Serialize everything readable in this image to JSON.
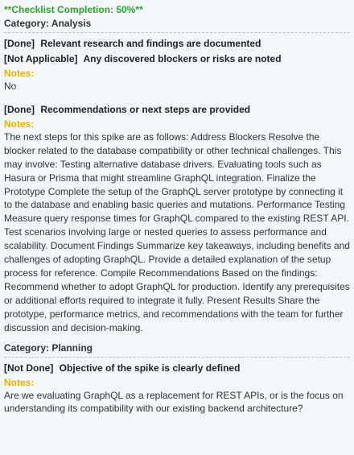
{
  "completion": "**Checklist Completion: 50%**",
  "categories": [
    {
      "label": "Category: Analysis",
      "items": [
        {
          "status": "[Done]",
          "text": "Relevant research and findings are documented"
        },
        {
          "status": "[Not Applicable]",
          "text": "Any discovered blockers or risks are noted",
          "notes_label": "Notes:",
          "notes": "No"
        },
        {
          "status": "[Done]",
          "text": "Recommendations or next steps are provided",
          "notes_label": "Notes:",
          "notes": "The next steps for this spike are as follows: Address Blockers Resolve the blocker related to the database compatibility or other technical challenges. This may involve: Testing alternative database drivers. Evaluating tools such as Hasura or Prisma that might streamline GraphQL integration. Finalize the Prototype Complete the setup of the GraphQL server prototype by connecting it to the database and enabling basic queries and mutations. Performance Testing Measure query response times for GraphQL compared to the existing REST API. Test scenarios involving large or nested queries to assess performance and scalability. Document Findings Summarize key takeaways, including benefits and challenges of adopting GraphQL. Provide a detailed explanation of the setup process for reference. Compile Recommendations Based on the findings: Recommend whether to adopt GraphQL for production. Identify any prerequisites or additional efforts required to integrate it fully. Present Results Share the prototype, performance metrics, and recommendations with the team for further discussion and decision-making."
        }
      ]
    },
    {
      "label": "Category: Planning",
      "items": [
        {
          "status": "[Not Done]",
          "text": "Objective of the spike is clearly defined",
          "notes_label": "Notes:",
          "notes": "Are we evaluating GraphQL as a replacement for REST APIs, or is the focus on understanding its compatibility with our existing backend architecture?"
        }
      ]
    }
  ]
}
